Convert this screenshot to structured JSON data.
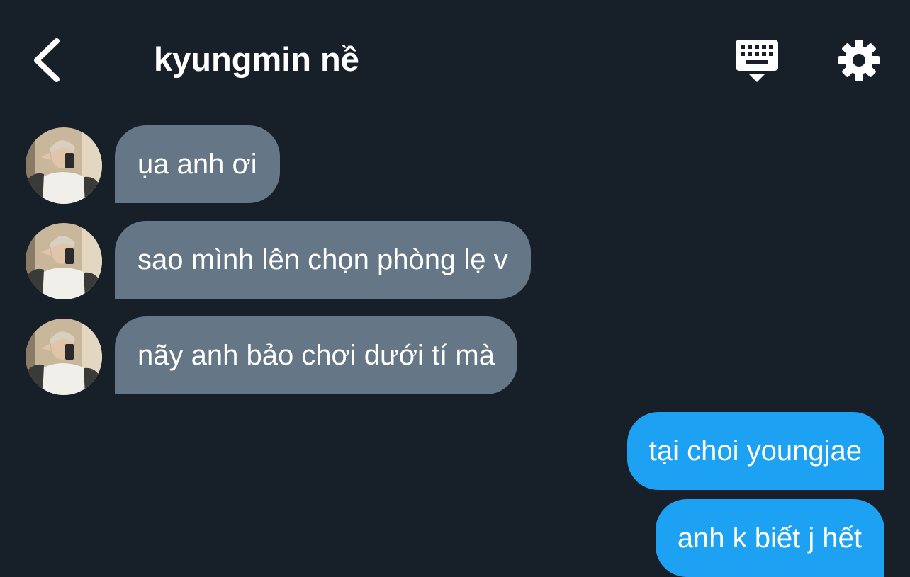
{
  "header": {
    "title": "kyungmin nề",
    "back_icon": "chevron-left-icon",
    "keyboard_icon": "keyboard-hide-icon",
    "settings_icon": "gear-icon"
  },
  "colors": {
    "background": "#171f29",
    "incoming_bubble": "#657786",
    "outgoing_bubble": "#1da1f2",
    "text": "#ffffff"
  },
  "messages": [
    {
      "direction": "incoming",
      "text": "ụa anh ơi"
    },
    {
      "direction": "incoming",
      "text": "sao mình lên chọn phòng lẹ v"
    },
    {
      "direction": "incoming",
      "text": "nãy anh bảo chơi dưới tí mà"
    },
    {
      "direction": "outgoing",
      "text": "tại choi youngjae"
    },
    {
      "direction": "outgoing",
      "text": "anh k biết j hết"
    }
  ]
}
